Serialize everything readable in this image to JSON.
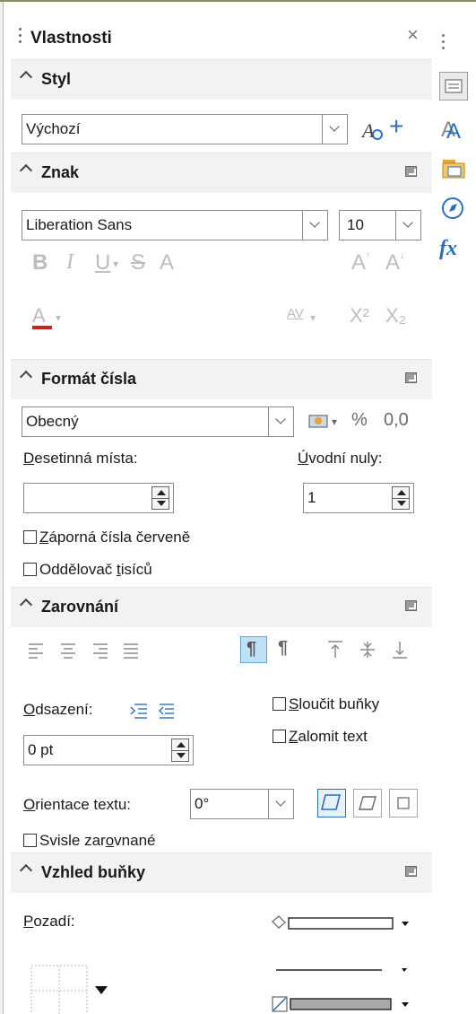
{
  "panel": {
    "title": "Vlastnosti",
    "close": "×"
  },
  "styl": {
    "header": "Styl",
    "value": "Výchozí",
    "plus": "+"
  },
  "znak": {
    "header": "Znak",
    "font": "Liberation Sans",
    "size": "10",
    "bold": "B",
    "italic": "I",
    "underline": "U",
    "strike": "S",
    "shadow": "A",
    "grow": "A",
    "shrink": "A",
    "fontcolor": "A",
    "spacing": "AV",
    "sup": "X²",
    "sub": "X₂"
  },
  "format": {
    "header": "Formát čísla",
    "category": "Obecný",
    "percent": "%",
    "decimal": "0,0",
    "decimals_label_u": "D",
    "decimals_label_rest": "esetinná místa:",
    "leading_label_u": "Ú",
    "leading_label_rest": "vodní nuly:",
    "decimals_value": "",
    "leading_value": "1",
    "negative_red_u": "Z",
    "negative_red_rest": "áporná čísla červeně",
    "thousands_pre": "Oddělovač ",
    "thousands_u": "t",
    "thousands_rest": "isíců"
  },
  "zarovnani": {
    "header": "Zarovnání",
    "indent_label_u": "O",
    "indent_label_rest": "dsazení:",
    "indent_value": "0 pt",
    "merge_u": "S",
    "merge_rest": "loučit buňky",
    "wrap_u": "Z",
    "wrap_rest": "alomit text",
    "orient_label_u": "O",
    "orient_label_rest": "rientace textu:",
    "orient_value": "0°",
    "vertical_pre": "Svisle zar",
    "vertical_u": "o",
    "vertical_rest": "vnané"
  },
  "vzhled": {
    "header": "Vzhled buňky",
    "background_u": "P",
    "background_rest": "ozadí:"
  },
  "colors": {
    "accent": "#2a6fbf",
    "fontcolor_bar": "#cc2222",
    "checked_bg": "#bfe0f5"
  }
}
